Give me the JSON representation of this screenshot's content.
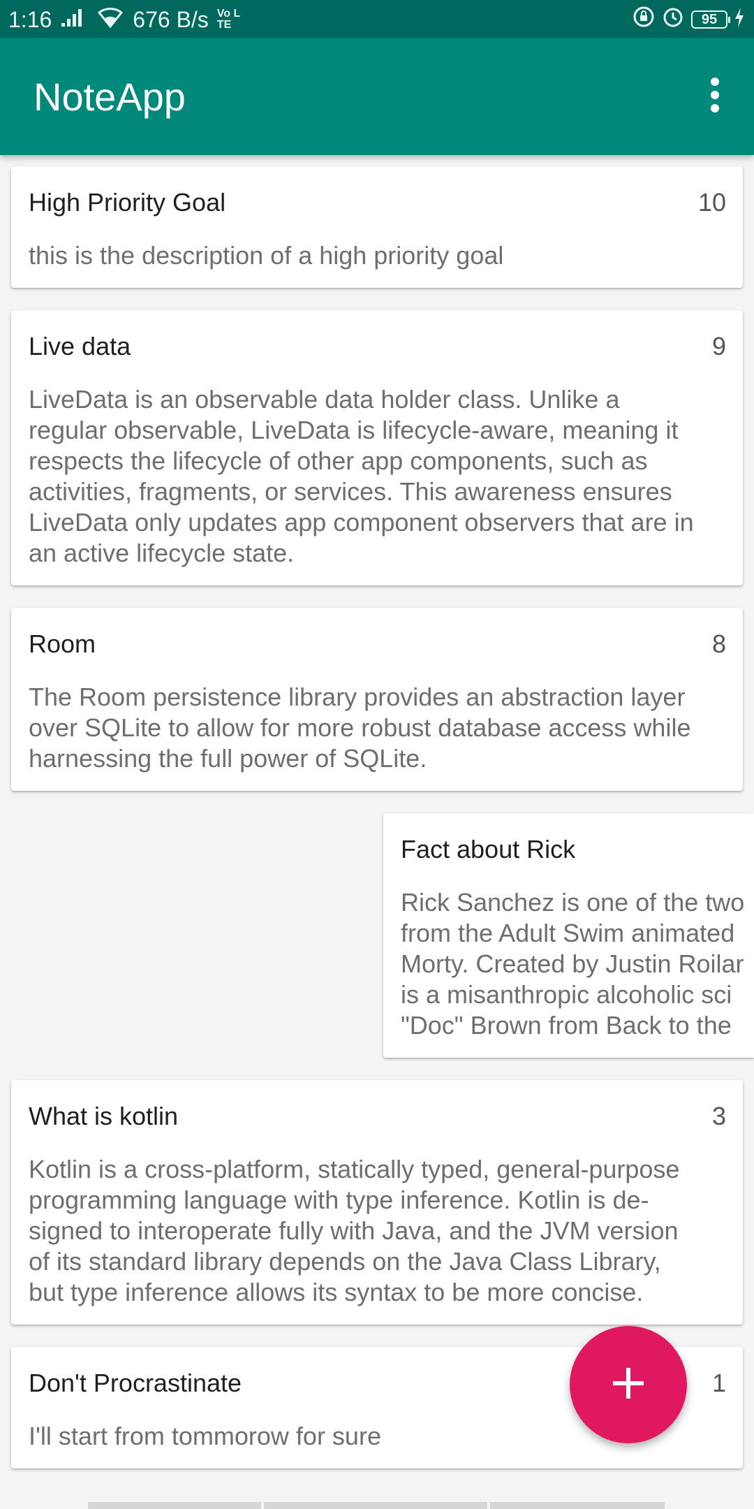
{
  "status_bar": {
    "time": "1:16",
    "net_speed": "676 B/s",
    "volte": "Vo LTE",
    "battery": "95"
  },
  "app_bar": {
    "title": "NoteApp",
    "menu_icon": "more-vert-icon"
  },
  "notes": [
    {
      "title": "High Priority Goal",
      "priority": "10",
      "description": "this is the description of a high priority goal"
    },
    {
      "title": "Live data",
      "priority": "9",
      "description": "LiveData is an observable data holder class. Unlike a\nregular observable, LiveData is lifecycle-aware, meaning it\nrespects the lifecycle of other app components, such as\nactivities, fragments, or services. This awareness ensures\nLiveData only updates app component observers that are in\nan active lifecycle state."
    },
    {
      "title": "Room",
      "priority": "8",
      "description": "The Room persistence library provides an abstraction layer\nover SQLite to allow for more robust database access while\nharnessing the full power of SQLite."
    },
    {
      "title": "Fact about Rick",
      "priority": "",
      "description": "Rick Sanchez is one of the two\nfrom the Adult Swim animated\nMorty. Created by Justin Roilar\nis a misanthropic alcoholic sci\n\"Doc\" Brown from Back to the"
    },
    {
      "title": "What is kotlin",
      "priority": "3",
      "description": "Kotlin is a cross-platform, statically typed, general-purpose\nprogramming language with type inference. Kotlin is de-\nsigned to interoperate fully with Java, and the JVM version\nof its standard library depends on the Java Class Library,\nbut type inference allows its syntax to be more concise."
    },
    {
      "title": "Don't Procrastinate",
      "priority": "1",
      "description": "I'll start from tommorow for sure"
    }
  ],
  "fab": {
    "icon": "add-icon",
    "color": "#e0185f"
  },
  "colors": {
    "primary": "#00897b",
    "primary_dark": "#00685d",
    "accent": "#e0185f"
  }
}
